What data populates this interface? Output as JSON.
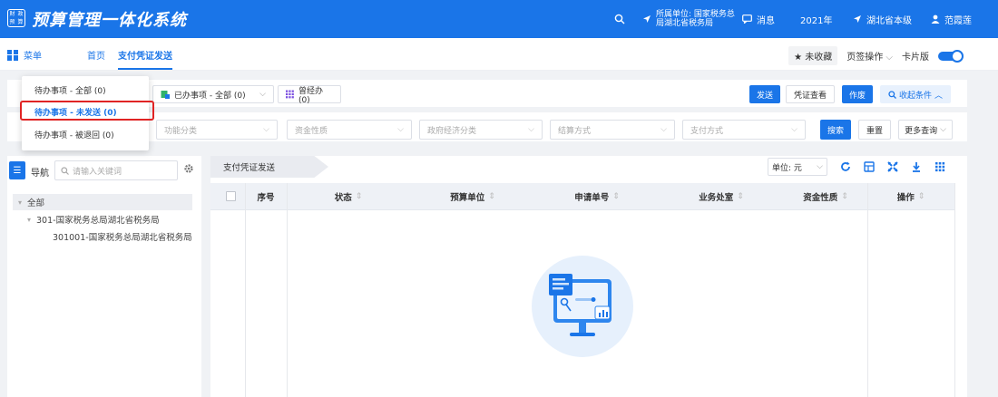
{
  "header": {
    "logo_chars": [
      "财",
      "政",
      "预",
      "算"
    ],
    "app_title": "预算管理一体化系统",
    "unit_label": "所属单位: 国家税务总局湖北省税务局",
    "message_label": "消息",
    "year_label": "2021年",
    "level_label": "湖北省本级",
    "user_name": "范霞莲"
  },
  "nav": {
    "menu_label": "菜单",
    "home_label": "首页",
    "active_tab_label": "支付凭证发送",
    "favorite_label": "★ 未收藏",
    "page_ops_label": "页签操作",
    "card_label": "卡片版"
  },
  "toolbar": {
    "done_tab": "已办事项 - 全部 (0)",
    "handled_tab": "曾经办 (0)",
    "send_button": "发送",
    "voucher_view_button": "凭证查看",
    "void_button": "作废",
    "collapse_button": "收起条件"
  },
  "dropdown": {
    "items": [
      "待办事项 - 全部 (0)",
      "待办事项 - 未发送 (0)",
      "待办事项 - 被退回 (0)"
    ]
  },
  "filters": {
    "fields": [
      "功能分类",
      "资金性质",
      "政府经济分类",
      "结算方式",
      "支付方式"
    ],
    "search_button": "搜索",
    "reset_button": "重置",
    "more_button": "更多查询"
  },
  "left_nav": {
    "title": "导航",
    "search_placeholder": "请输入关键词",
    "tree": [
      "全部",
      "301-国家税务总局湖北省税务局",
      "301001-国家税务总局湖北省税务局"
    ]
  },
  "content": {
    "breadcrumb": "支付凭证发送",
    "unit_select": "单位: 元",
    "columns": [
      "序号",
      "状态",
      "预算单位",
      "申请单号",
      "业务处室",
      "资金性质",
      "操作"
    ]
  },
  "colors": {
    "primary": "#1a75e8",
    "highlight": "#e02424"
  }
}
